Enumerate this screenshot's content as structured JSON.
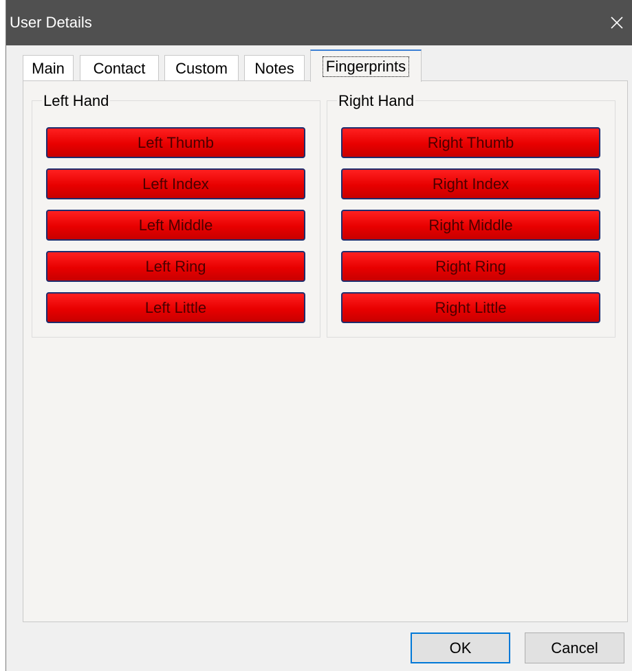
{
  "window": {
    "title": "User Details",
    "close_icon": "close-icon"
  },
  "tabs": [
    {
      "label": "Main",
      "active": false
    },
    {
      "label": "Contact",
      "active": false
    },
    {
      "label": "Custom",
      "active": false
    },
    {
      "label": "Notes",
      "active": false
    },
    {
      "label": "Fingerprints",
      "active": true
    }
  ],
  "fingerprints": {
    "left_hand": {
      "label": "Left Hand",
      "buttons": [
        "Left Thumb",
        "Left Index",
        "Left Middle",
        "Left Ring",
        "Left Little"
      ]
    },
    "right_hand": {
      "label": "Right Hand",
      "buttons": [
        "Right Thumb",
        "Right Index",
        "Right Middle",
        "Right Ring",
        "Right Little"
      ]
    }
  },
  "footer": {
    "ok_label": "OK",
    "cancel_label": "Cancel"
  },
  "colors": {
    "titlebar": "#505050",
    "finger_button": "#e80000",
    "finger_button_border": "#1e2d6e",
    "active_tab_accent": "#3c7fd4",
    "ok_focus": "#0078d7"
  }
}
